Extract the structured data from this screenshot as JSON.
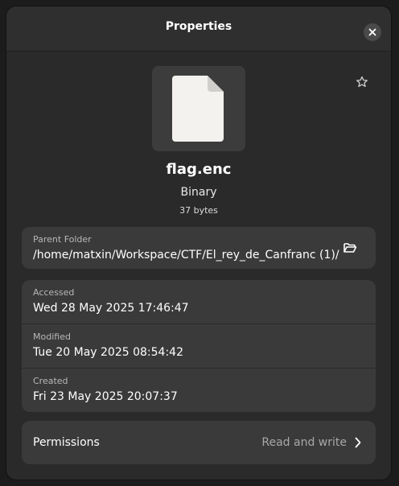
{
  "dialog": {
    "title": "Properties",
    "close_icon": "close-icon"
  },
  "file": {
    "icon": "document-icon",
    "name": "flag.enc",
    "type": "Binary",
    "size": "37 bytes",
    "star_icon": "star-outline-icon"
  },
  "parent_folder": {
    "label": "Parent Folder",
    "path": "/home/matxin/Workspace/CTF/El_rey_de_Canfranc (1)/",
    "open_icon": "open-folder-icon"
  },
  "dates": [
    {
      "label": "Accessed",
      "value": "Wed 28 May 2025 17:46:47"
    },
    {
      "label": "Modified",
      "value": "Tue 20 May 2025 08:54:42"
    },
    {
      "label": "Created",
      "value": "Fri 23 May 2025 20:07:37"
    }
  ],
  "permissions": {
    "label": "Permissions",
    "value": "Read and write",
    "chevron_icon": "chevron-right-icon"
  },
  "colors": {
    "dialog_bg": "#2a2a2a",
    "header_bg": "#2f2f2f",
    "card_bg": "#3a3a3a",
    "text_primary": "#ffffff",
    "text_dim": "#b8b8b8"
  }
}
